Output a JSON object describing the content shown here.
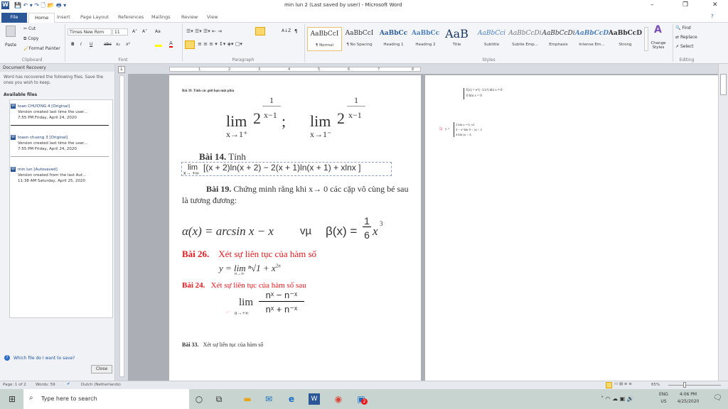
{
  "window": {
    "title": "min lun 2 (Last saved by user) - Microsoft Word",
    "minimize": "–",
    "restore": "❐",
    "close": "✕",
    "help": "?"
  },
  "tabs": [
    "File",
    "Home",
    "Insert",
    "Page Layout",
    "References",
    "Mailings",
    "Review",
    "View"
  ],
  "ribbon": {
    "clipboard": {
      "paste": "Paste",
      "cut": "Cut",
      "copy": "Copy",
      "format_painter": "Format Painter",
      "label": "Clipboard"
    },
    "font": {
      "name": "Times New Rom",
      "size": "11",
      "label": "Font",
      "bold": "B",
      "italic": "I",
      "underline": "U",
      "strike": "abc",
      "sub": "x₂",
      "sup": "x²",
      "grow": "A˄",
      "shrink": "A˅",
      "case": "Aa",
      "color": "A"
    },
    "paragraph": {
      "label": "Paragraph",
      "pilcrow": "¶",
      "sort": "A↓Z"
    },
    "styles": {
      "label": "Styles",
      "items": [
        {
          "sample": "AaBbCcI",
          "name": "¶ Normal"
        },
        {
          "sample": "AaBbCcI",
          "name": "¶ No Spacing"
        },
        {
          "sample": "AaBbCc",
          "name": "Heading 1"
        },
        {
          "sample": "AaBbCc",
          "name": "Heading 2"
        },
        {
          "sample": "AaB",
          "name": "Title"
        },
        {
          "sample": "AaBbCci",
          "name": "Subtitle"
        },
        {
          "sample": "AaBbCcDi",
          "name": "Subtle Emp..."
        },
        {
          "sample": "AaBbCcDi",
          "name": "Emphasis"
        },
        {
          "sample": "AaBbCcD",
          "name": "Intense Em..."
        },
        {
          "sample": "AaBbCcD",
          "name": "Strong"
        }
      ],
      "change_styles": "Change Styles"
    },
    "editing": {
      "label": "Editing",
      "find": "Find",
      "replace": "Replace",
      "select": "Select"
    }
  },
  "recovery": {
    "title": "Document Recovery",
    "message": "Word has recovered the following files.  Save the ones you wish to keep.",
    "available": "Available files",
    "files": [
      {
        "name": "toan CHƯƠNG 4  [Original]",
        "desc": "Version created last time the user...",
        "time": "7:55 PM Friday, April 24, 2020"
      },
      {
        "name": "toasn chuong 3  [Original]",
        "desc": "Version created last time the user...",
        "time": "7:55 PM Friday, April 24, 2020"
      },
      {
        "name": "min lun  [Autosaved]",
        "desc": "Version created from the last Aut...",
        "time": "11:38 AM Saturday, April 25, 2020"
      }
    ],
    "help": "Which file do I want to save?",
    "close": "Close"
  },
  "ruler": [
    "1",
    "2",
    "3",
    "4",
    "5",
    "6",
    "7",
    "8"
  ],
  "page1": {
    "bai39": "Bài 39.  Tính các giới hạn một phía",
    "lim": "lim",
    "two": "2",
    "one": "1",
    "xm1": "x−1",
    "semi": ";",
    "sub1": "x→1⁺",
    "sub2": "x→1⁻",
    "bai14_b": "Bài 14.",
    "bai14_t": " Tính",
    "eq14": "[(x + 2)ln(x + 2) − 2(x + 1)ln(x + 1) + xlnx ]",
    "eq14_sub": "x→ +∞",
    "bai19_b": "Bài 19.",
    "bai19_t": "  Chứng minh rằng khi x→ 0 các cặp vô cùng bé sau là tương đương:",
    "alpha": "α(x) = arcsin x − x",
    "vm": "vµ",
    "beta": "β(x) =",
    "frac_n": "1",
    "frac_d": "6",
    "x3": "x",
    "exp3": "3",
    "bai26_b": "Bài 26.",
    "bai26_t": "Xét sự liên tục của hàm số",
    "eq26": "y = lim ⁿ√1 + x",
    "eq26_exp": "2n",
    "eq26_sub": "n→∞",
    "bai24_b": "Bài 24.",
    "bai24_t": "Xét sự liên tục của hàm số sau",
    "eq24_num": "nˣ − n⁻ˣ",
    "eq24_den": "nˣ + n⁻ˣ",
    "eq24_sub": "n→+∞",
    "eq24_y": "y =",
    "bai33_b": "Bài 33.",
    "bai33_t": "Xét sự liên tục của  hàm số"
  },
  "page2": {
    "f_line1": "f(x) = e^(−1/x²)   khi  x ≠ 0",
    "f_line2": "0        khi  x = 0",
    "item": "5)",
    "y_lines": [
      "2          khi  x = 0, ±2",
      "4 − x²   khi  0 < |x| < 2",
      "4          khi  |x| > 2;"
    ],
    "y": "y ="
  },
  "status": {
    "page": "Page: 1 of 2",
    "words": "Words: 59",
    "language": "Dutch (Netherlands)",
    "zoom": "65%",
    "zoom_level": 65
  },
  "taskbar": {
    "search": "Type here to search",
    "lang1": "ENG",
    "lang2": "US",
    "time": "4:06 PM",
    "date": "4/25/2020",
    "badge": "2"
  }
}
